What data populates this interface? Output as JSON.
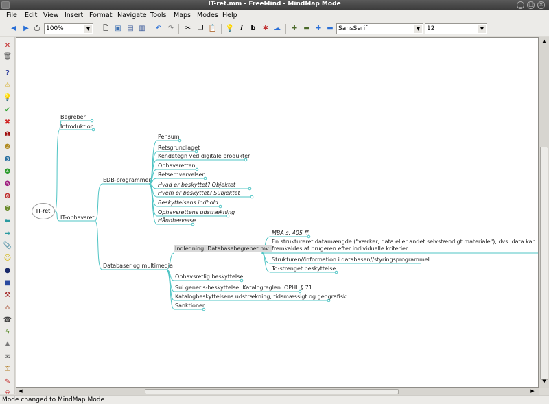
{
  "window": {
    "title": "IT-ret.mm - FreeMind - MindMap Mode"
  },
  "menu": [
    "File",
    "Edit",
    "View",
    "Insert",
    "Format",
    "Navigate",
    "Tools",
    "Maps",
    "Modes",
    "Help"
  ],
  "toolbar": {
    "zoom": "100%",
    "font_family": "SansSerif",
    "font_size": "12"
  },
  "mindmap": {
    "root": "IT-ret",
    "begreber": "Begreber",
    "introduktion": "Introduktion",
    "it_ophavsret": "IT-ophavsret",
    "edb_programmer": "EDB-programmer",
    "edb_children": [
      "Pensum",
      "Retsgrundlaget",
      "Kendetegn ved digitale produkter",
      "Ophavsretten",
      "Retserhvervelsen",
      "Hvad er beskyttet? Objektet",
      "Hvem er beskyttet? Subjektet",
      "Beskyttelsens indhold",
      "Ophavsrettens udstrækning",
      "Håndhævelse"
    ],
    "databaser": "Databaser og multimedia",
    "indledning": "Indledning. Databasebegrebet mv.",
    "mba": "MBA s. 405 ff.",
    "struktureret_1": "En struktureret datamængde (\"værker, data eller andet selvstændigt materiale\"), dvs. data kan",
    "struktureret_2": "fremkaldes af brugeren efter individuelle kriterier.",
    "strukturen": "Strukturen//information i databasen//styringsprogrammel",
    "to_strenget": "To-strenget beskyttelse",
    "db_children": [
      "Ophavsretlig beskyttelse",
      "Sui generis-beskyttelse. Katalogreglen. OPHL § 71",
      "Katalogbeskyttelsens udstrækning, tidsmæssigt og geografisk",
      "Sanktioner"
    ]
  },
  "status": "Mode changed to MindMap Mode",
  "colors": {
    "edge": "#4fc4c4",
    "canvas": "#ffffff",
    "chrome": "#ecebe8"
  }
}
